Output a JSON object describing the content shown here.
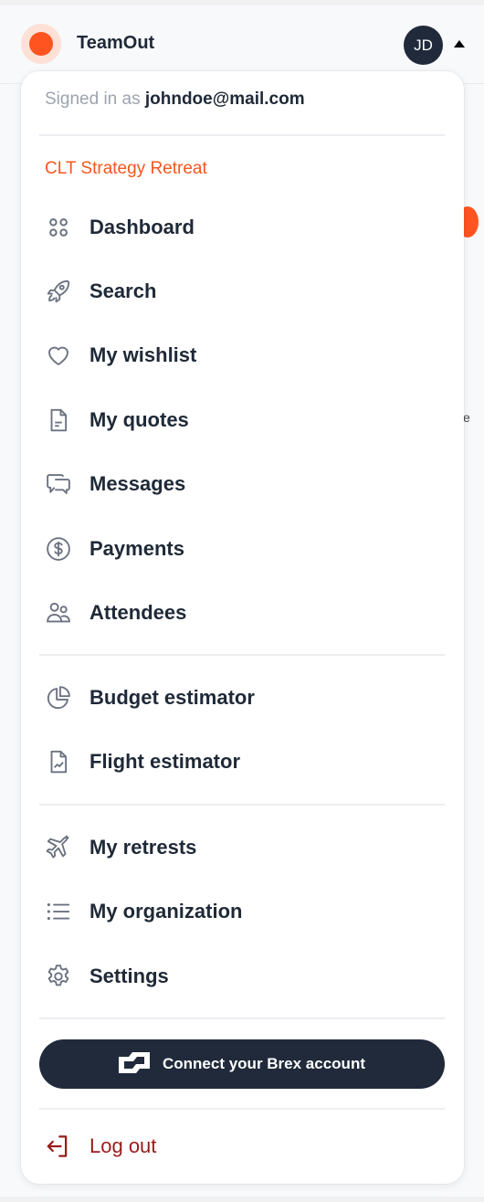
{
  "header": {
    "brand": "TeamOut",
    "avatar_initials": "JD",
    "colors": {
      "brand": "#ff5420",
      "avatar_bg": "#202a3b"
    }
  },
  "menu": {
    "signed_in_prefix": "Signed in as",
    "signed_in_email": "johndoe@mail.com",
    "current_event": "CLT Strategy Retreat",
    "event_items": [
      {
        "label": "Dashboard",
        "icon": "dashboard-icon"
      },
      {
        "label": "Search",
        "icon": "rocket-icon"
      },
      {
        "label": "My wishlist",
        "icon": "heart-icon"
      },
      {
        "label": "My quotes",
        "icon": "document-icon"
      },
      {
        "label": "Messages",
        "icon": "chat-bubbles-icon"
      },
      {
        "label": "Payments",
        "icon": "dollar-circle-icon"
      },
      {
        "label": "Attendees",
        "icon": "users-icon"
      }
    ],
    "tool_items": [
      {
        "label": "Budget estimator",
        "icon": "pie-chart-icon"
      },
      {
        "label": "Flight estimator",
        "icon": "chart-document-icon"
      }
    ],
    "account_items": [
      {
        "label": "My retrests",
        "icon": "airplane-icon"
      },
      {
        "label": "My organization",
        "icon": "list-icon"
      },
      {
        "label": "Settings",
        "icon": "gear-icon"
      }
    ],
    "brex_button": "Connect your Brex account",
    "logout": "Log out",
    "colors": {
      "accent": "#f4561e",
      "logout": "#991b1b",
      "text": "#1f2937",
      "icon": "#6b7280"
    }
  }
}
